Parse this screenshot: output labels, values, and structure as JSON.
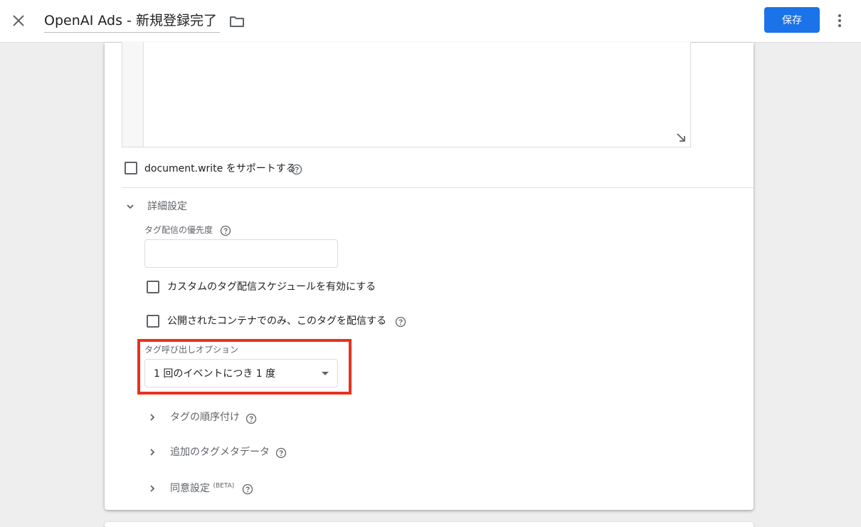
{
  "topbar": {
    "title": "OpenAI Ads - 新規登録完了",
    "save_label": "保存"
  },
  "html_tag": {
    "document_write_label": "document.write をサポートする"
  },
  "advanced": {
    "section_label": "詳細設定",
    "priority_label": "タグ配信の優先度",
    "priority_value": "",
    "schedule_label": "カスタムのタグ配信スケジュールを有効にする",
    "schedule_checked": false,
    "published_only_label": "公開されたコンテナでのみ、このタグを配信する",
    "published_only_checked": false,
    "firing_option_label": "タグ呼び出しオプション",
    "firing_option_value": "1 回のイベントにつき 1 度",
    "sequencing_label": "タグの順序付け",
    "metadata_label": "追加のタグメタデータ",
    "consent_label": "同意設定",
    "consent_badge": "(BETA)"
  },
  "colors": {
    "accent": "#1a73e8",
    "highlight": "#e8321e"
  }
}
